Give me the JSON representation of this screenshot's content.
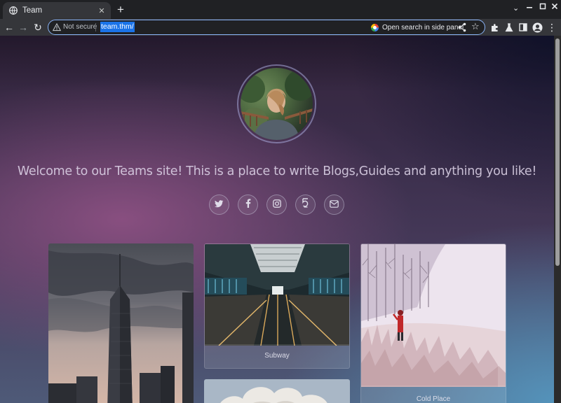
{
  "browser": {
    "tab_title": "Team",
    "tab_close": "✕",
    "new_tab": "+",
    "not_secure": "Not secure",
    "url": "team.thm/",
    "side_panel": "Open search in side panel",
    "star": "☆",
    "back": "←",
    "forward": "→",
    "reload": "↻",
    "menu": "⋮",
    "minimize": "⌄",
    "restore": "▢",
    "close": "✕"
  },
  "page": {
    "welcome": "Welcome to our Teams site! This is a place to write Blogs,Guides and anything you like!",
    "social_icons": [
      "twitter-icon",
      "facebook-icon",
      "instagram-icon",
      "five-hundred-px-icon",
      "email-icon"
    ],
    "cards": [
      {
        "caption": ""
      },
      {
        "caption": "Subway"
      },
      {
        "caption": "Cold Place"
      },
      {
        "caption": ""
      }
    ]
  },
  "colors": {
    "accent": "#8ab4f8",
    "chrome_dark": "#202124",
    "chrome_tab": "#35363a",
    "url_highlight": "#1a73e8"
  }
}
